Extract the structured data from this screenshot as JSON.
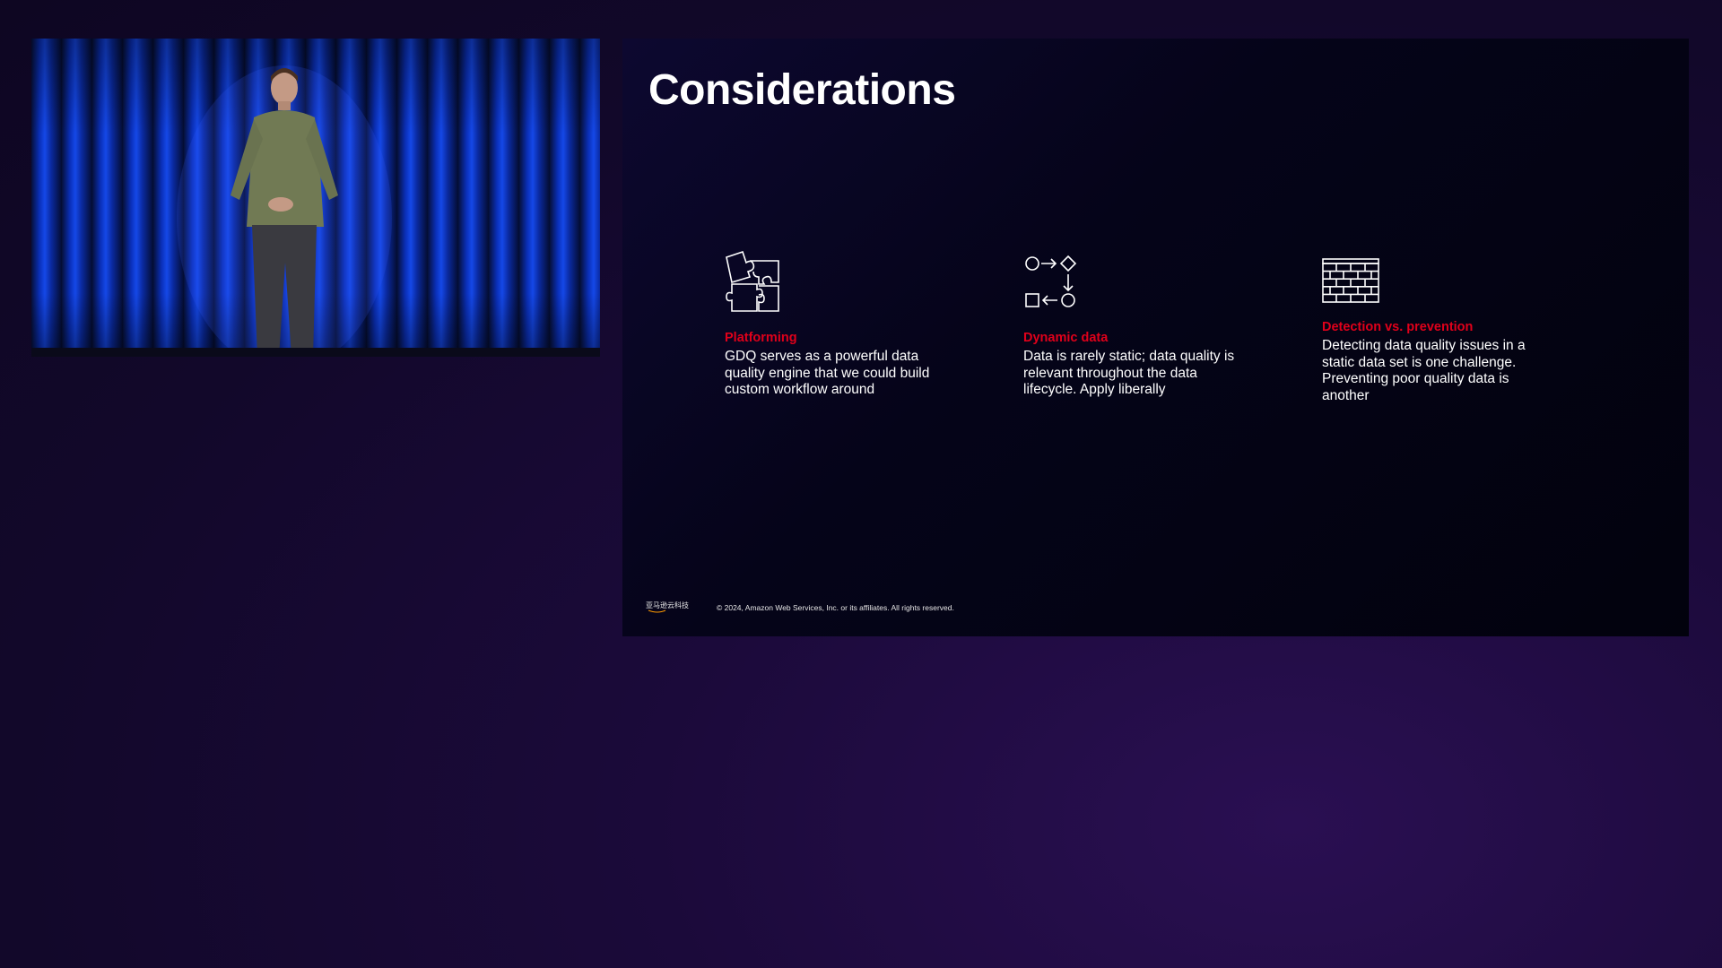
{
  "slide": {
    "title": "Considerations",
    "columns": [
      {
        "icon": "puzzle-icon",
        "heading": "Platforming",
        "body": "GDQ serves as a powerful data quality engine that we could build custom workflow around"
      },
      {
        "icon": "workflow-shapes-icon",
        "heading": "Dynamic data",
        "body": "Data is rarely static; data quality is relevant throughout the data lifecycle. Apply liberally"
      },
      {
        "icon": "brick-wall-icon",
        "heading": "Detection vs. prevention",
        "body": "Detecting data quality issues in a static data set is one challenge. Preventing poor quality data is another"
      }
    ],
    "footer": {
      "logo_text": "亚马逊云科技",
      "copyright": "© 2024, Amazon Web Services, Inc. or its affiliates. All rights reserved."
    }
  },
  "colors": {
    "accent": "#e0001a",
    "text": "#ffffff"
  }
}
